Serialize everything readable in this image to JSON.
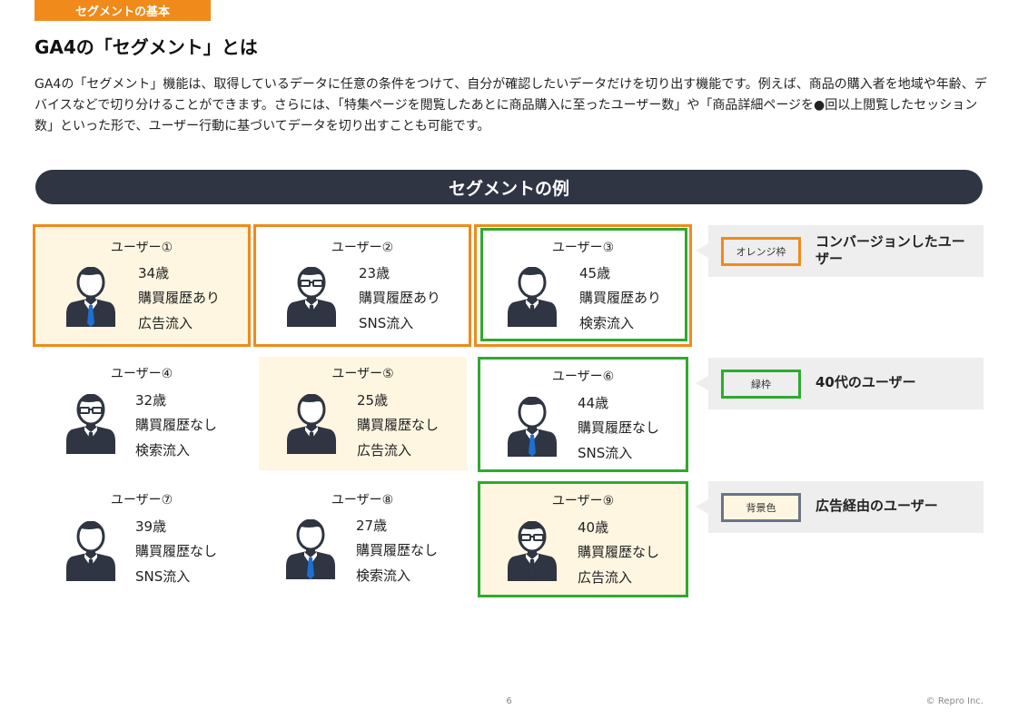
{
  "header": {
    "section_tag": "セグメントの基本",
    "title": "GA4の「セグメント」とは",
    "intro": "GA4の「セグメント」機能は、取得しているデータに任意の条件をつけて、自分が確認したいデータだけを切り出す機能です。例えば、商品の購入者を地域や年齢、デバイスなどで切り分けることができます。さらには、「特集ページを閲覧したあとに商品購入に至ったユーザー数」や「商品詳細ページを●回以上閲覧したセッション数」といった形で、ユーザー行動に基づいてデータを切り出すことも可能です。"
  },
  "banner": {
    "title": "セグメントの例"
  },
  "colors": {
    "orange": "#f08a1a",
    "green": "#2eaa2e",
    "background_highlight": "#fff6e1",
    "banner": "#2f3542",
    "legend_bg": "#eeeeee",
    "background_swatch_border": "#6b7386"
  },
  "users": [
    {
      "name": "ユーザー①",
      "age": "34歳",
      "purchase": "購買履歴あり",
      "source": "広告流入",
      "avatar": "person-blue-tie-icon"
    },
    {
      "name": "ユーザー②",
      "age": "23歳",
      "purchase": "購買履歴あり",
      "source": "SNS流入",
      "avatar": "person-glasses-icon"
    },
    {
      "name": "ユーザー③",
      "age": "45歳",
      "purchase": "購買履歴あり",
      "source": "検索流入",
      "avatar": "person-icon"
    },
    {
      "name": "ユーザー④",
      "age": "32歳",
      "purchase": "購買履歴なし",
      "source": "検索流入",
      "avatar": "person-glasses-icon"
    },
    {
      "name": "ユーザー⑤",
      "age": "25歳",
      "purchase": "購買履歴なし",
      "source": "広告流入",
      "avatar": "person-icon"
    },
    {
      "name": "ユーザー⑥",
      "age": "44歳",
      "purchase": "購買履歴なし",
      "source": "SNS流入",
      "avatar": "person-blue-tie-icon"
    },
    {
      "name": "ユーザー⑦",
      "age": "39歳",
      "purchase": "購買履歴なし",
      "source": "SNS流入",
      "avatar": "person-icon"
    },
    {
      "name": "ユーザー⑧",
      "age": "27歳",
      "purchase": "購買履歴なし",
      "source": "検索流入",
      "avatar": "person-blue-tie-icon"
    },
    {
      "name": "ユーザー⑨",
      "age": "40歳",
      "purchase": "購買履歴なし",
      "source": "広告流入",
      "avatar": "person-glasses-icon"
    }
  ],
  "legend": [
    {
      "label": "オレンジ枠",
      "description": "コンバージョンしたユーザー"
    },
    {
      "label": "緑枠",
      "description": "40代のユーザー"
    },
    {
      "label": "背景色",
      "description": "広告経由のユーザー"
    }
  ],
  "footer": {
    "page": "6",
    "copyright": "© Repro Inc."
  }
}
